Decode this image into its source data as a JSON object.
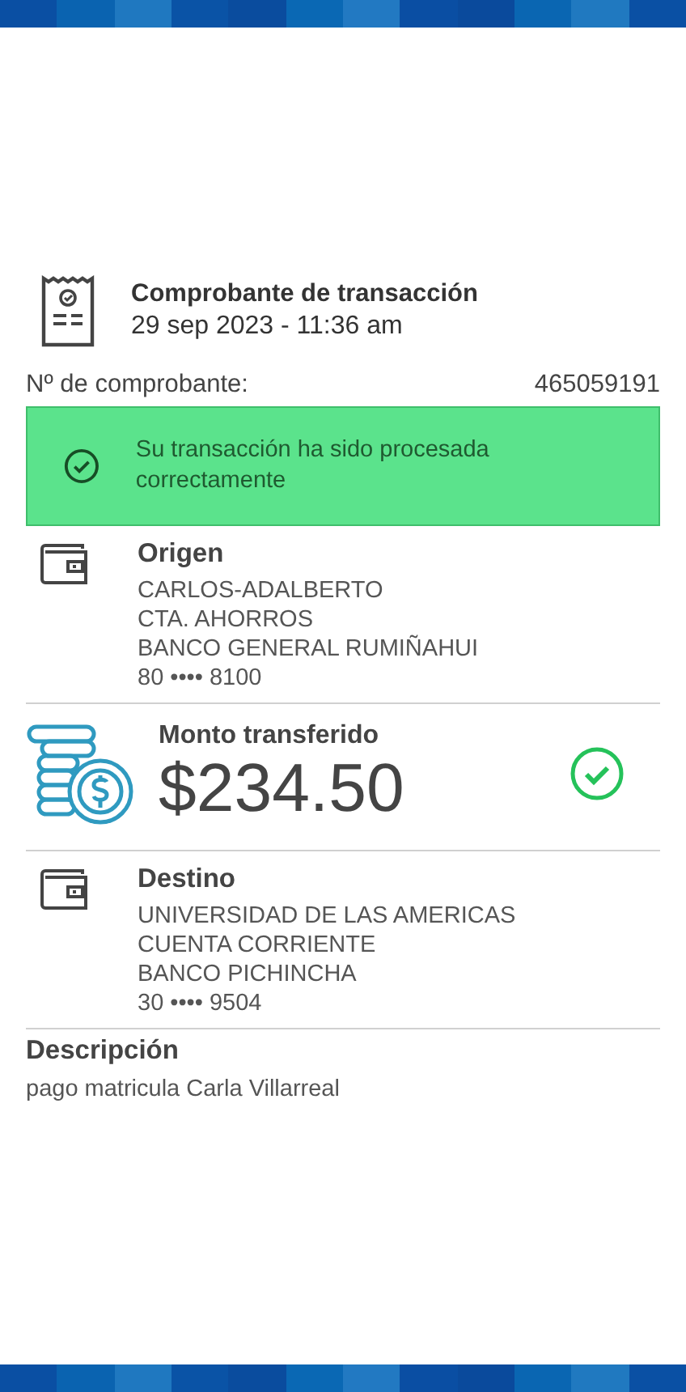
{
  "header": {
    "title": "Comprobante de transacción",
    "datetime": "29 sep 2023 - 11:36 am"
  },
  "voucher": {
    "label": "Nº de comprobante:",
    "number": "465059191"
  },
  "status": {
    "message": "Su transacción ha sido procesada correctamente"
  },
  "origin": {
    "title": "Origen",
    "lines": [
      "CARLOS-ADALBERTO",
      "CTA. AHORROS",
      "BANCO GENERAL RUMIÑAHUI",
      "80 •••• 8100"
    ]
  },
  "amount": {
    "title": "Monto transferido",
    "value": "$234.50"
  },
  "destination": {
    "title": "Destino",
    "lines": [
      "UNIVERSIDAD DE LAS AMERICAS",
      "CUENTA CORRIENTE",
      "BANCO PICHINCHA",
      "30 •••• 9504"
    ]
  },
  "description": {
    "title": "Descripción",
    "text": "pago matricula Carla Villarreal"
  }
}
